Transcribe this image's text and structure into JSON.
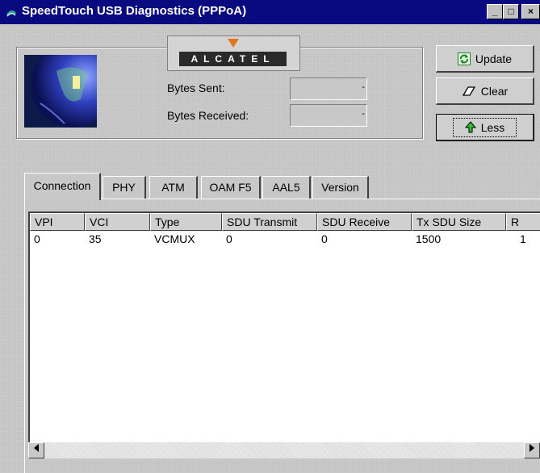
{
  "window": {
    "title": "SpeedTouch USB Diagnostics (PPPoA)",
    "controls": {
      "minimize": "_",
      "maximize": "□",
      "close": "×"
    }
  },
  "logo": {
    "text": "ALCATEL",
    "triangle_color": "#e07820"
  },
  "stats": {
    "bytes_sent_label": "Bytes Sent:",
    "bytes_received_label": "Bytes Received:",
    "bytes_sent_value": "-",
    "bytes_received_value": "-"
  },
  "buttons": {
    "update": "Update",
    "clear": "Clear",
    "less": "Less"
  },
  "tabs": [
    "Connection",
    "PHY",
    "ATM",
    "OAM F5",
    "AAL5",
    "Version"
  ],
  "table": {
    "columns": [
      "VPI",
      "VCI",
      "Type",
      "SDU Transmit",
      "SDU Receive",
      "Tx SDU Size",
      "R"
    ],
    "rows": [
      [
        "0",
        "35",
        "VCMUX",
        "0",
        "0",
        "1500",
        "1"
      ]
    ]
  },
  "colors": {
    "titlebar": "#0a0a80",
    "face": "#c8c8c8",
    "update_icon": "#1a8a1a",
    "less_arrow": "#2ec02e"
  }
}
